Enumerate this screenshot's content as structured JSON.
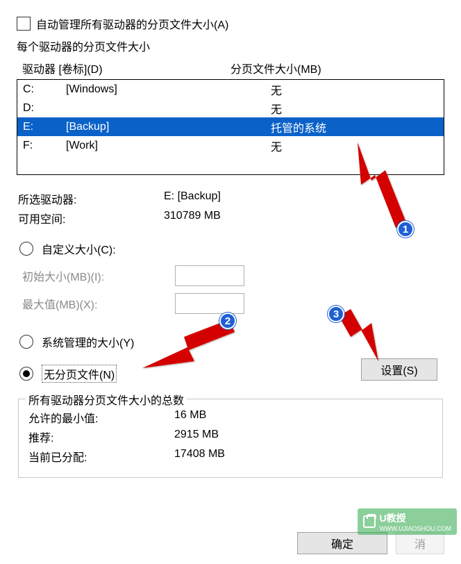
{
  "auto_manage": {
    "checked": false,
    "label": "自动管理所有驱动器的分页文件大小(A)"
  },
  "drives_section": {
    "title": "每个驱动器的分页文件大小",
    "col_drive": "驱动器 [卷标](D)",
    "col_pf": "分页文件大小(MB)",
    "rows": [
      {
        "letter": "C:",
        "label": "[Windows]",
        "pf": "无",
        "selected": false
      },
      {
        "letter": "D:",
        "label": "",
        "pf": "无",
        "selected": false
      },
      {
        "letter": "E:",
        "label": "[Backup]",
        "pf": "托管的系统",
        "selected": true
      },
      {
        "letter": "F:",
        "label": "[Work]",
        "pf": "无",
        "selected": false
      }
    ]
  },
  "selected_drive_label": "所选驱动器:",
  "selected_drive_value": "E:  [Backup]",
  "free_space_label": "可用空间:",
  "free_space_value": "310789 MB",
  "custom_size_label": "自定义大小(C):",
  "initial_label": "初始大小(MB)(I):",
  "initial_value": "",
  "max_label": "最大值(MB)(X):",
  "max_value": "",
  "system_managed_label": "系统管理的大小(Y)",
  "no_pagefile_label": "无分页文件(N)",
  "set_button": "设置(S)",
  "totals": {
    "legend": "所有驱动器分页文件大小的总数",
    "min_label": "允许的最小值:",
    "min_value": "16 MB",
    "rec_label": "推荐:",
    "rec_value": "2915 MB",
    "cur_label": "当前已分配:",
    "cur_value": "17408 MB"
  },
  "buttons": {
    "ok": "确定",
    "cancel": "消"
  },
  "annotations": {
    "b1": "1",
    "b2": "2",
    "b3": "3"
  },
  "watermark": {
    "brand": "U教授",
    "url": "WWW.UJIAOSHOU.COM"
  }
}
